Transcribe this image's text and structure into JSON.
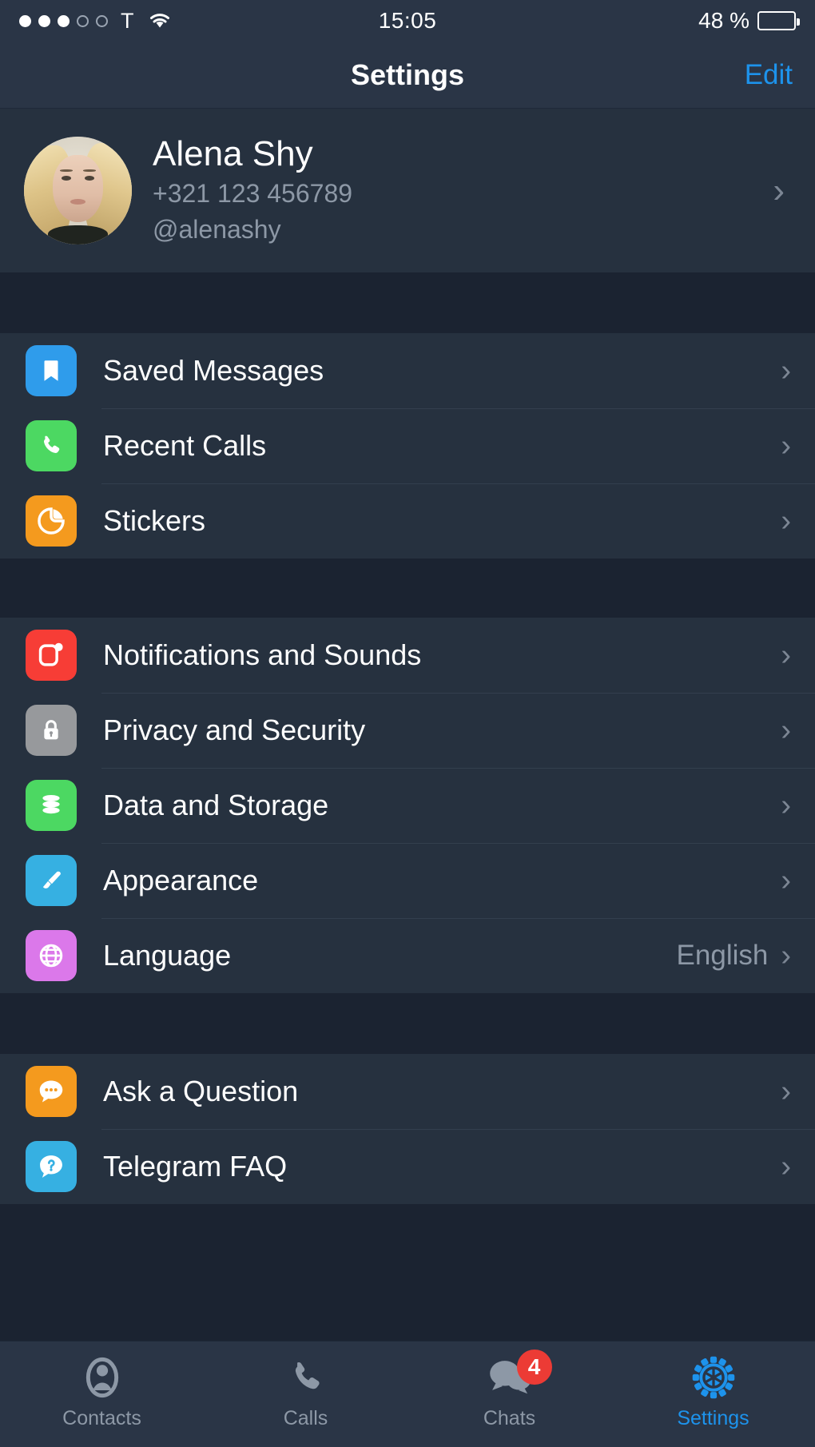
{
  "statusbar": {
    "signal_filled": 3,
    "signal_total": 5,
    "carrier": "T",
    "wifi_icon": "wifi-icon",
    "time": "15:05",
    "battery_text": "48 %",
    "battery_percent": 48
  },
  "navbar": {
    "title": "Settings",
    "edit_label": "Edit"
  },
  "profile": {
    "avatar_icon": "user-avatar-photo",
    "name": "Alena Shy",
    "phone": "+321 123 456789",
    "username": "@alenashy",
    "chevron_icon": "chevron-right-icon"
  },
  "groups": [
    {
      "id": "group-chats",
      "rows": [
        {
          "id": "saved-messages",
          "label": "Saved Messages",
          "icon": "bookmark-icon",
          "color": "#2f9ceb",
          "value": ""
        },
        {
          "id": "recent-calls",
          "label": "Recent Calls",
          "icon": "phone-icon",
          "color": "#4cd862",
          "value": ""
        },
        {
          "id": "stickers",
          "label": "Stickers",
          "icon": "sticker-icon",
          "color": "#f49a1e",
          "value": ""
        }
      ]
    },
    {
      "id": "group-preferences",
      "rows": [
        {
          "id": "notifications-and-sounds",
          "label": "Notifications and Sounds",
          "icon": "notification-bell-icon",
          "color": "#f73d36",
          "value": ""
        },
        {
          "id": "privacy-and-security",
          "label": "Privacy and Security",
          "icon": "lock-icon",
          "color": "#97999c",
          "value": ""
        },
        {
          "id": "data-and-storage",
          "label": "Data and Storage",
          "icon": "database-icon",
          "color": "#4cd862",
          "value": ""
        },
        {
          "id": "appearance",
          "label": "Appearance",
          "icon": "paintbrush-icon",
          "color": "#36b0e2",
          "value": ""
        },
        {
          "id": "language",
          "label": "Language",
          "icon": "globe-icon",
          "color": "#db78ea",
          "value": "English"
        }
      ]
    },
    {
      "id": "group-support",
      "rows": [
        {
          "id": "ask-a-question",
          "label": "Ask a Question",
          "icon": "chat-bubble-icon",
          "color": "#f49a1e",
          "value": ""
        },
        {
          "id": "telegram-faq",
          "label": "Telegram FAQ",
          "icon": "question-bubble-icon",
          "color": "#36b0e2",
          "value": ""
        }
      ]
    }
  ],
  "tabbar": {
    "tabs": [
      {
        "id": "contacts",
        "label": "Contacts",
        "icon": "contact-person-icon",
        "badge": "",
        "active": false
      },
      {
        "id": "calls",
        "label": "Calls",
        "icon": "phone-handset-icon",
        "badge": "",
        "active": false
      },
      {
        "id": "chats",
        "label": "Chats",
        "icon": "chat-bubbles-icon",
        "badge": "4",
        "active": false
      },
      {
        "id": "settings",
        "label": "Settings",
        "icon": "gear-icon",
        "badge": "",
        "active": true
      }
    ]
  },
  "colors": {
    "row_bg": "#26313f",
    "gap_bg": "#1b2331",
    "bar_bg": "#2a3546",
    "accent": "#1d93ec",
    "text_primary": "#ffffff",
    "text_secondary": "#8d98a6",
    "badge_red": "#ec3b35"
  }
}
